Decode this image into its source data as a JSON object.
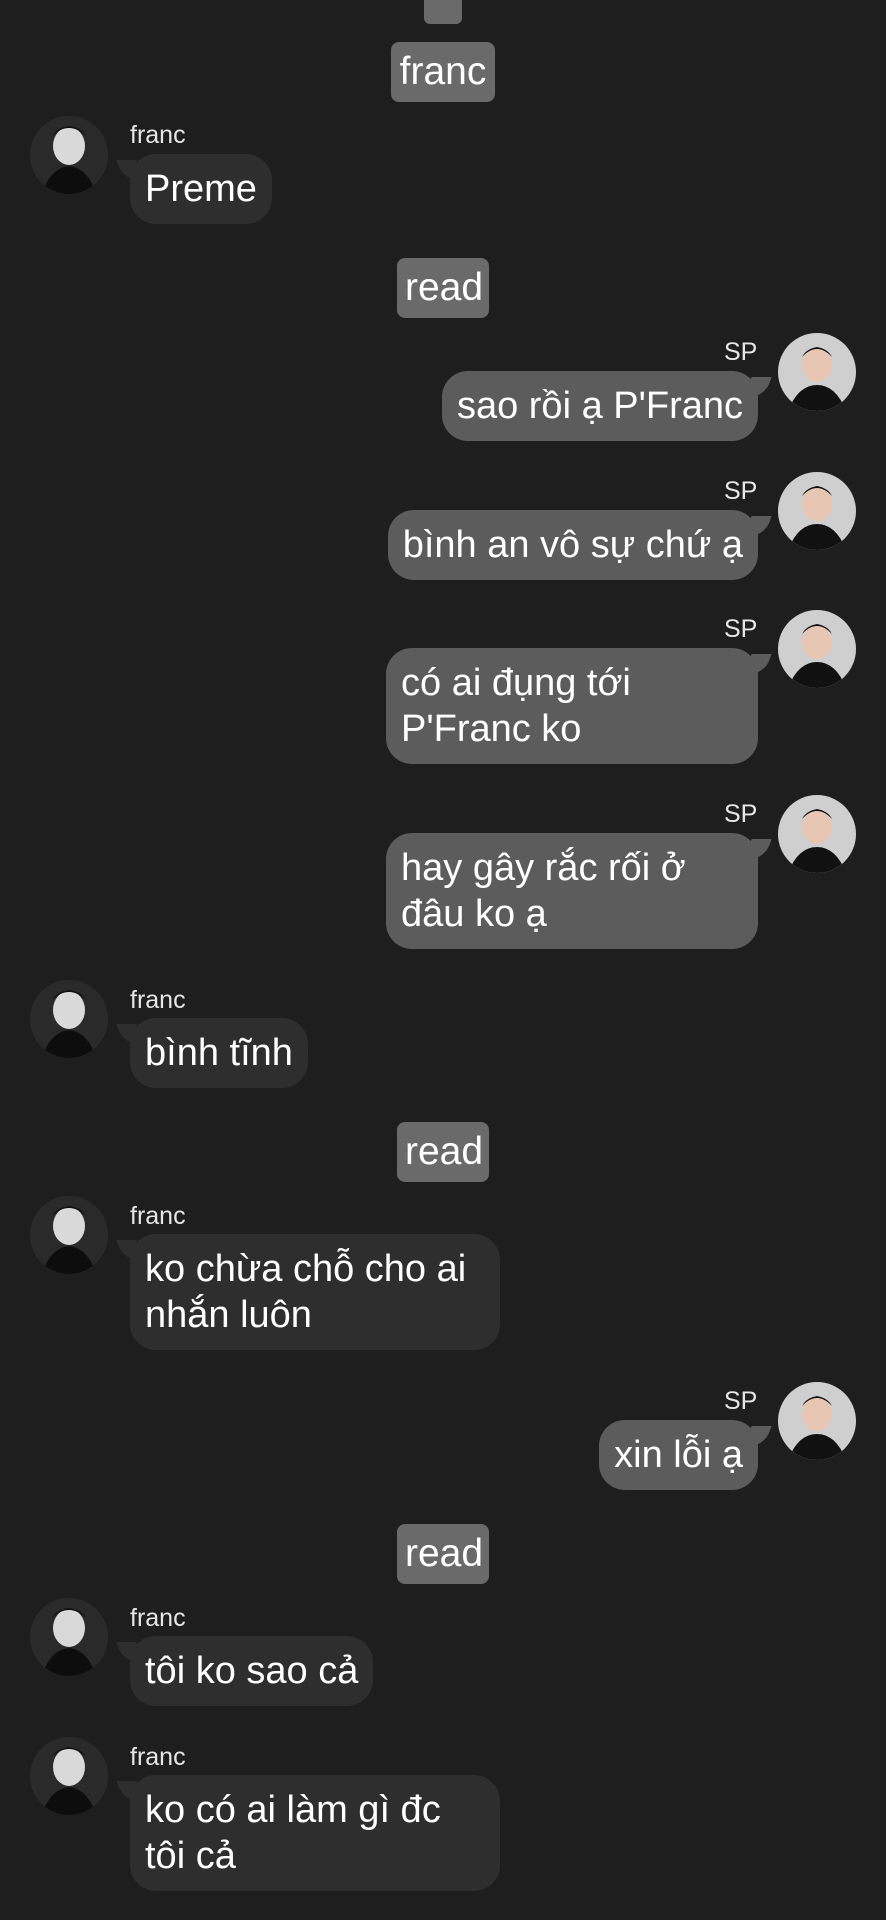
{
  "colors": {
    "background": "#1e1e1e",
    "incoming_bubble": "#2e2e2e",
    "outgoing_bubble": "#5c5c5c",
    "pill": "#6a6a6a"
  },
  "messages": [
    {
      "type": "label",
      "text": "franc"
    },
    {
      "type": "incoming",
      "sender": "franc",
      "text": "Preme"
    },
    {
      "type": "label",
      "text": "read"
    },
    {
      "type": "outgoing",
      "sender": "SP",
      "text": "sao rồi ạ P'Franc"
    },
    {
      "type": "outgoing",
      "sender": "SP",
      "text": "bình an vô sự chứ ạ"
    },
    {
      "type": "outgoing",
      "sender": "SP",
      "lines": [
        "có ai đụng tới",
        "P'Franc ko"
      ]
    },
    {
      "type": "outgoing",
      "sender": "SP",
      "lines": [
        "hay gây rắc rối ở",
        "đâu ko ạ"
      ]
    },
    {
      "type": "incoming",
      "sender": "franc",
      "text": "bình tĩnh"
    },
    {
      "type": "label",
      "text": "read"
    },
    {
      "type": "incoming",
      "sender": "franc",
      "lines": [
        "ko chừa chỗ cho ai",
        "nhắn luôn"
      ]
    },
    {
      "type": "outgoing",
      "sender": "SP",
      "text": "xin lỗi ạ"
    },
    {
      "type": "label",
      "text": "read"
    },
    {
      "type": "incoming",
      "sender": "franc",
      "text": "tôi ko sao cả"
    },
    {
      "type": "incoming",
      "sender": "franc",
      "lines": [
        "ko có ai làm gì đc",
        "tôi cả"
      ]
    }
  ]
}
